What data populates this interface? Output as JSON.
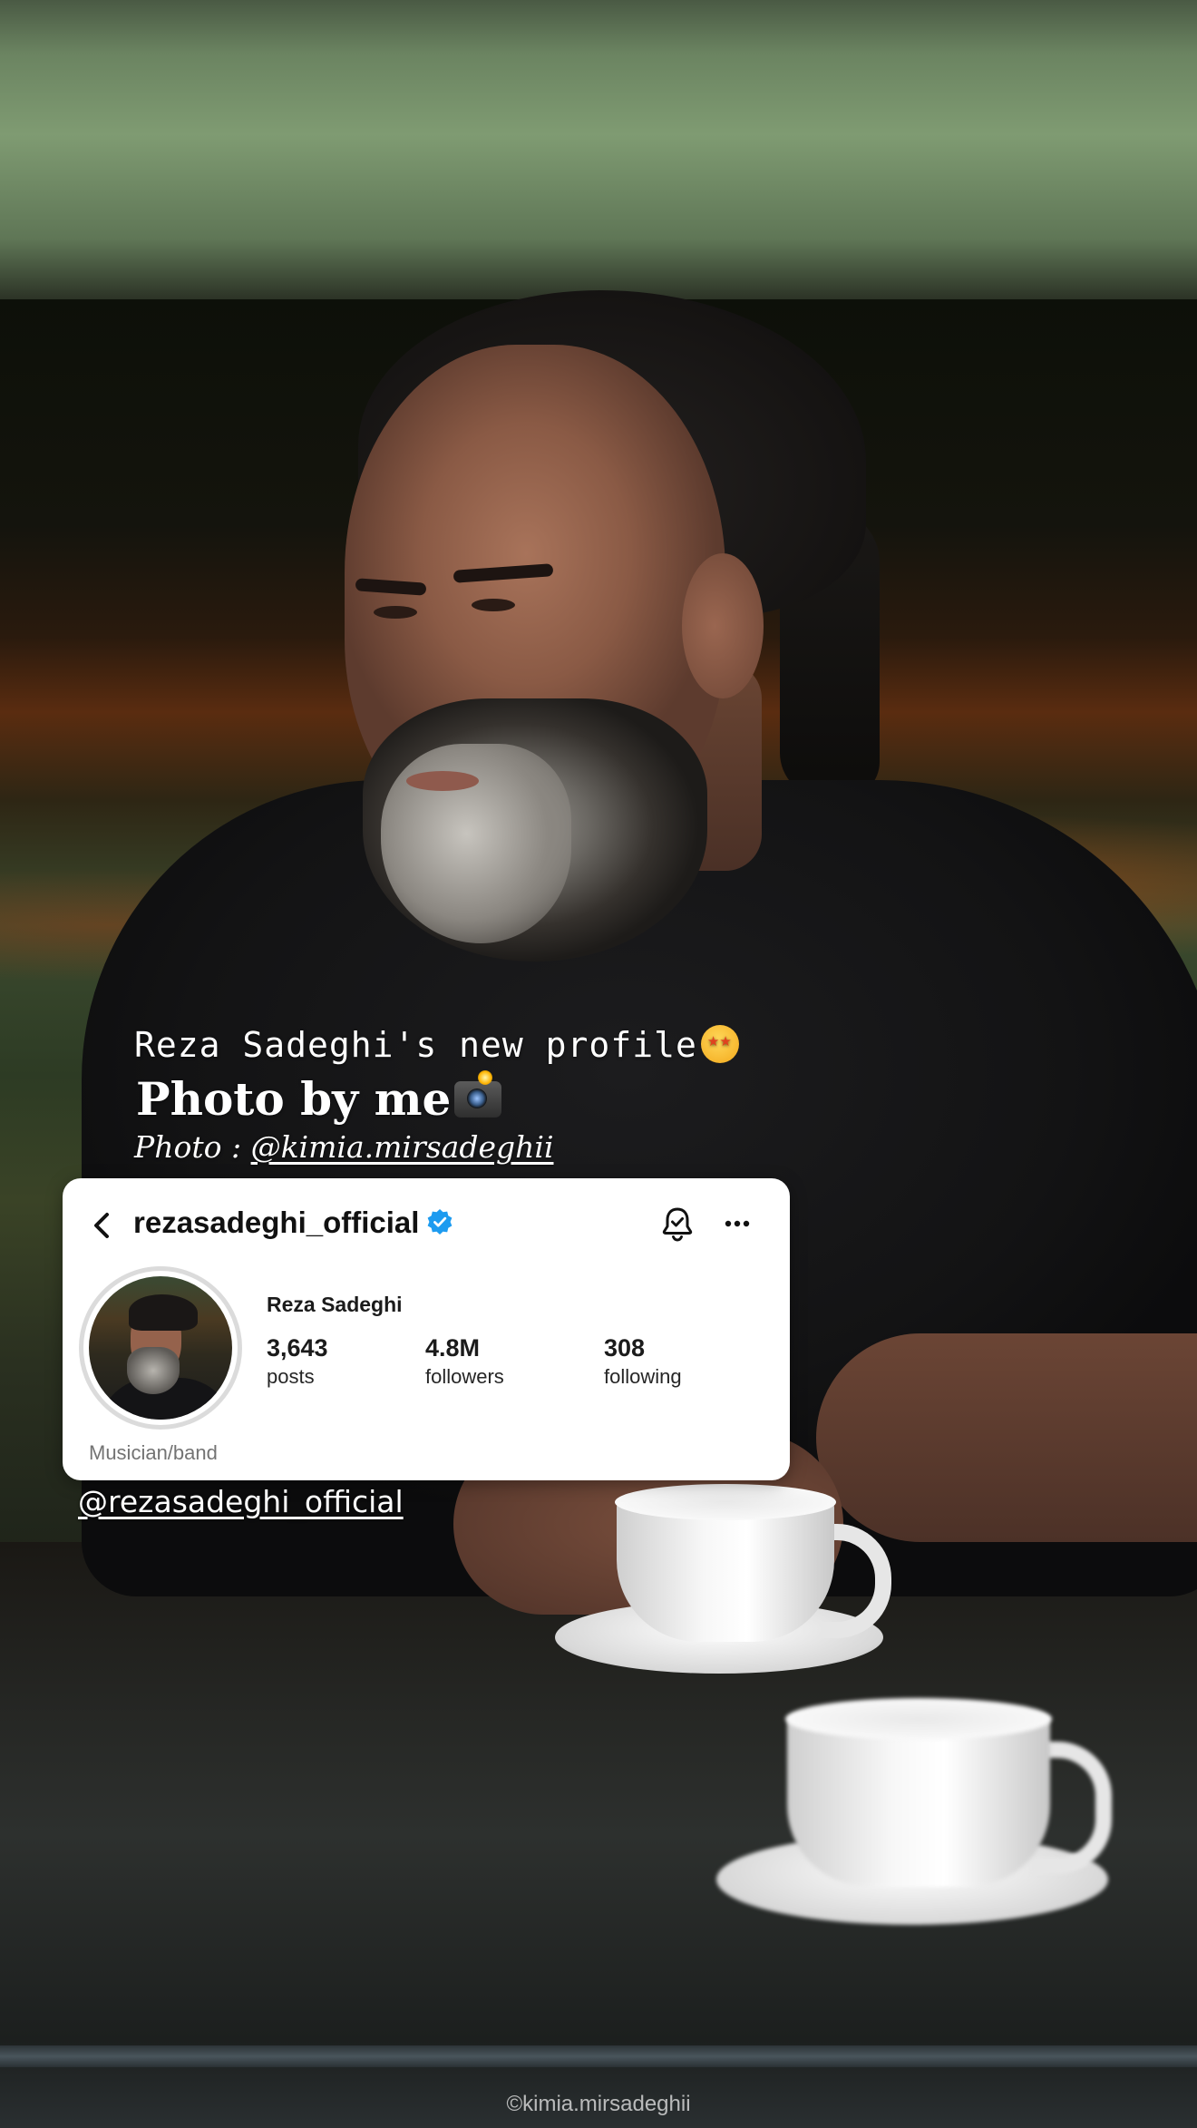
{
  "story": {
    "line1": "Reza Sadeghi's new profile",
    "line1_emoji": "star-struck-emoji",
    "line2": "Photo by me",
    "line2_emoji": "camera-with-flash-emoji",
    "line3_prefix": "Photo : ",
    "line3_mention": "@kimia.mirsadeghii"
  },
  "profile": {
    "username": "rezasadeghi_official",
    "verified": true,
    "verified_color": "#1DA1F2",
    "full_name": "Reza Sadeghi",
    "stats": [
      {
        "value": "3,643",
        "label": "posts"
      },
      {
        "value": "4.8M",
        "label": "followers"
      },
      {
        "value": "308",
        "label": "following"
      }
    ],
    "category": "Musician/band",
    "icons": [
      "back-arrow-icon",
      "verified-badge-icon",
      "notification-bell-icon",
      "more-options-icon"
    ]
  },
  "mention_below": "@rezasadeghi_official",
  "watermark": "©kimia.mirsadeghii"
}
